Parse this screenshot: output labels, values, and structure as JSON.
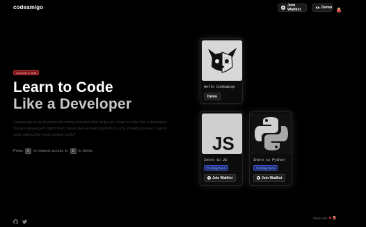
{
  "header": {
    "logo": "codeamigo",
    "waitlist_label": "Join Waitlist",
    "demo_label": "Demo"
  },
  "hero": {
    "badge": "Currently in beta",
    "title_line1": "Learn to Code",
    "title_line2": "Like a Developer",
    "description": "Codeamigo is an AI powered coding assistant that helps you learn to code like a developer. Today's developers didn't learn binary before learning Python, why should you learn how to code without the most modern tools?",
    "press_prefix": "Press",
    "key_a": "A",
    "press_mid": "to request access or",
    "key_d": "D",
    "press_suffix": "to demo."
  },
  "cards": [
    {
      "title": "Hello Codeamigo",
      "button": "Demo"
    },
    {
      "title": "Intro to JS",
      "status": "Coming Soon",
      "button": "Join Waitlist",
      "image_text": "JS"
    },
    {
      "title": "Intro to Python",
      "status": "Coming Soon",
      "button": "Join Waitlist"
    }
  ],
  "footer": {
    "made_with": "Made with",
    "icons": [
      "github-icon",
      "twitter-icon",
      "heart-icon",
      "avatar-icon"
    ]
  },
  "colors": {
    "background": "#000000",
    "badge_bg": "#7a1414",
    "coming_soon_bg": "#1e2f78",
    "heart": "#e23b3b"
  }
}
